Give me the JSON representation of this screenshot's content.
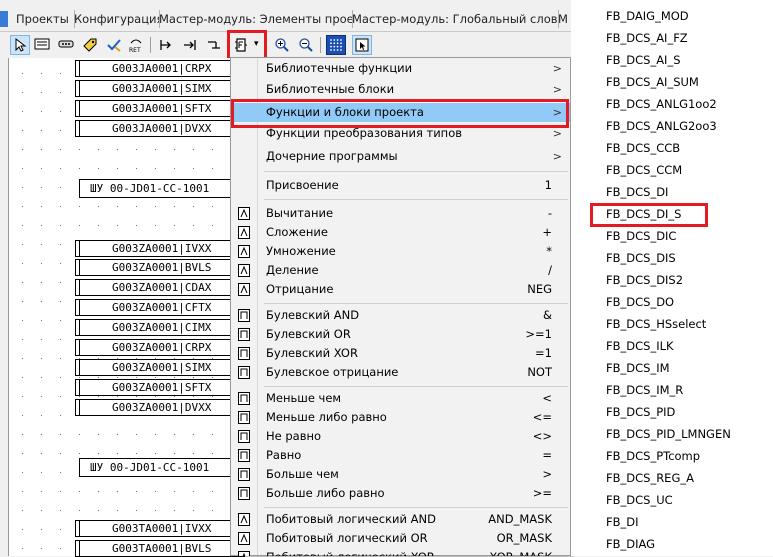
{
  "tabs": [
    "Проекты",
    "Конфигурация",
    "Мастер-модуль: Элементы проекта",
    "Мастер-модуль: Глобальный словарь",
    "М"
  ],
  "toolbar": {
    "icons": [
      "pointer-icon",
      "block-icon",
      "link-icon",
      "tag-icon",
      "check-icon",
      "ret-icon",
      "in-icon",
      "out-icon",
      "connector-icon",
      "function-block-icon",
      "zoom-in-icon",
      "zoom-out-icon",
      "grid-icon",
      "help-pointer-icon"
    ],
    "dropdown_arrow": "▾"
  },
  "canvas": {
    "group1": [
      "G003JA0001|CRPX",
      "G003JA0001|SIMX",
      "G003JA0001|SFTX",
      "G003JA0001|DVXX"
    ],
    "shu1": "ШУ 00-JD01-CC-1001",
    "group2": [
      "G003ZA0001|IVXX",
      "G003ZA0001|BVLS",
      "G003ZA0001|CDAX",
      "G003ZA0001|CFTX",
      "G003ZA0001|CIMX",
      "G003ZA0001|CRPX",
      "G003ZA0001|SIMX",
      "G003ZA0001|SFTX",
      "G003ZA0001|DVXX"
    ],
    "shu2": "ШУ 00-JD01-CC-1001",
    "group3": [
      "G003TA0001|IVXX",
      "G003TA0001|BVLS"
    ]
  },
  "menu": {
    "submenus": [
      "Библиотечные функции",
      "Библиотечные блоки",
      "Функции и блоки проекта",
      "Функции преобразования типов",
      "Дочерние программы"
    ],
    "submenu_arrow": ">",
    "assign": {
      "label": "Присвоение",
      "shortcut": "1"
    },
    "arith": [
      {
        "label": "Вычитание",
        "shortcut": "-"
      },
      {
        "label": "Сложение",
        "shortcut": "+"
      },
      {
        "label": "Умножение",
        "shortcut": "*"
      },
      {
        "label": "Деление",
        "shortcut": "/"
      },
      {
        "label": "Отрицание",
        "shortcut": "NEG"
      }
    ],
    "bool": [
      {
        "label": "Булевский AND",
        "shortcut": "&"
      },
      {
        "label": "Булевский OR",
        "shortcut": ">=1"
      },
      {
        "label": "Булевский XOR",
        "shortcut": "=1"
      },
      {
        "label": "Булевское отрицание",
        "shortcut": "NOT"
      }
    ],
    "compare": [
      {
        "label": "Меньше чем",
        "shortcut": "<"
      },
      {
        "label": "Меньше либо равно",
        "shortcut": "<="
      },
      {
        "label": "Не равно",
        "shortcut": "<>"
      },
      {
        "label": "Равно",
        "shortcut": "="
      },
      {
        "label": "Больше чем",
        "shortcut": ">"
      },
      {
        "label": "Больше либо равно",
        "shortcut": ">="
      }
    ],
    "bitwise": [
      {
        "label": "Побитовый логический AND",
        "shortcut": "AND_MASK"
      },
      {
        "label": "Побитовый логический OR",
        "shortcut": "OR_MASK"
      },
      {
        "label": "Побитовый логический XOR",
        "shortcut": "XOR_MASK"
      }
    ]
  },
  "function_list": [
    "FB_DAIG_MOD",
    "FB_DCS_AI_FZ",
    "FB_DCS_AI_S",
    "FB_DCS_AI_SUM",
    "FB_DCS_ANLG1oo2",
    "FB_DCS_ANLG2oo3",
    "FB_DCS_CCB",
    "FB_DCS_CCM",
    "FB_DCS_DI",
    "FB_DCS_DI_S",
    "FB_DCS_DIC",
    "FB_DCS_DIS",
    "FB_DCS_DIS2",
    "FB_DCS_DO",
    "FB_DCS_HSselect",
    "FB_DCS_ILK",
    "FB_DCS_IM",
    "FB_DCS_IM_R",
    "FB_DCS_PID",
    "FB_DCS_PID_LMNGEN",
    "FB_DCS_PTcomp",
    "FB_DCS_REG_A",
    "FB_DCS_UC",
    "FB_DI",
    "FB_DIAG"
  ],
  "colors": {
    "highlight": "#91c9f7",
    "red_box": "#e51b24",
    "grid_button": "#1b4fb3"
  }
}
